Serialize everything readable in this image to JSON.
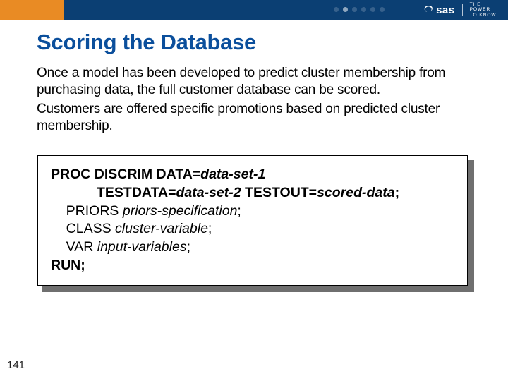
{
  "brand": {
    "name": "sas",
    "tagline_l1": "THE",
    "tagline_l2": "POWER",
    "tagline_l3": "TO KNOW."
  },
  "title": "Scoring the Database",
  "para1": "Once a model has been developed to predict cluster membership from purchasing data, the full customer database can be scored.",
  "para2": "Customers are offered specific promotions based on predicted cluster membership.",
  "code": {
    "l1a": "PROC DISCRIM DATA=",
    "l1b": "data-set-1",
    "l2a": "            TESTDATA=",
    "l2b": "data-set-2",
    "l2c": " TESTOUT=",
    "l2d": "scored-data",
    "l2e": ";",
    "l3a": "    PRIORS ",
    "l3b": "priors-specification",
    "l3c": ";",
    "l4a": "    CLASS ",
    "l4b": "cluster-variable",
    "l4c": ";",
    "l5a": "    VAR ",
    "l5b": "input-variables",
    "l5c": ";",
    "l6a": "RUN;"
  },
  "page": "141"
}
